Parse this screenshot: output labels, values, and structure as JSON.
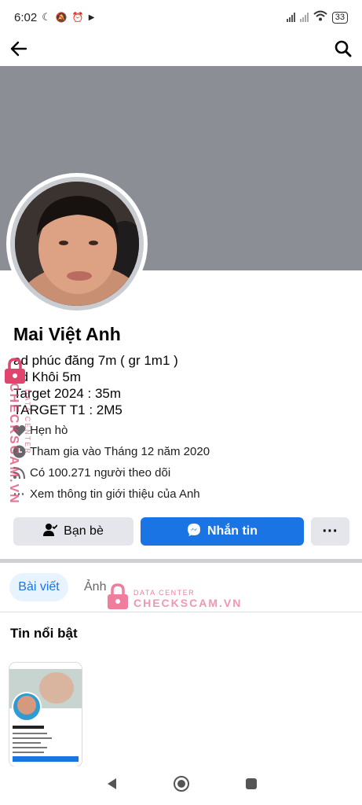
{
  "status_bar": {
    "time": "6:02",
    "battery": "33"
  },
  "profile": {
    "name": "Mai Việt Anh",
    "bio_lines": [
      "ad phúc đăng 7m ( gr 1m1 )",
      "ad Khôi 5m",
      "Target 2024 : 35m",
      "TARGET T1 : 2M5"
    ],
    "info": {
      "relationship": "Hẹn hò",
      "joined": "Tham gia vào Tháng 12 năm 2020",
      "followers": "Có 100.271 người theo dõi",
      "about": "Xem thông tin giới thiệu của Anh"
    }
  },
  "actions": {
    "friends_label": "Bạn bè",
    "message_label": "Nhắn tin"
  },
  "tabs": {
    "posts": "Bài viết",
    "photos": "Ảnh"
  },
  "featured": {
    "title": "Tin nổi bật"
  },
  "watermark": {
    "small": "DATA CENTER",
    "big": "CHECKSCAM.VN"
  },
  "colors": {
    "accent": "#1b74e4",
    "cover": "#8b8e94",
    "watermark": "#e0456e"
  },
  "icons": [
    "back-arrow-icon",
    "search-icon",
    "heart-icon",
    "clock-icon",
    "rss-icon",
    "dots-icon",
    "add-friend-icon",
    "messenger-icon",
    "more-icon",
    "lock-icon",
    "nav-back-icon",
    "nav-home-icon",
    "nav-recents-icon"
  ]
}
